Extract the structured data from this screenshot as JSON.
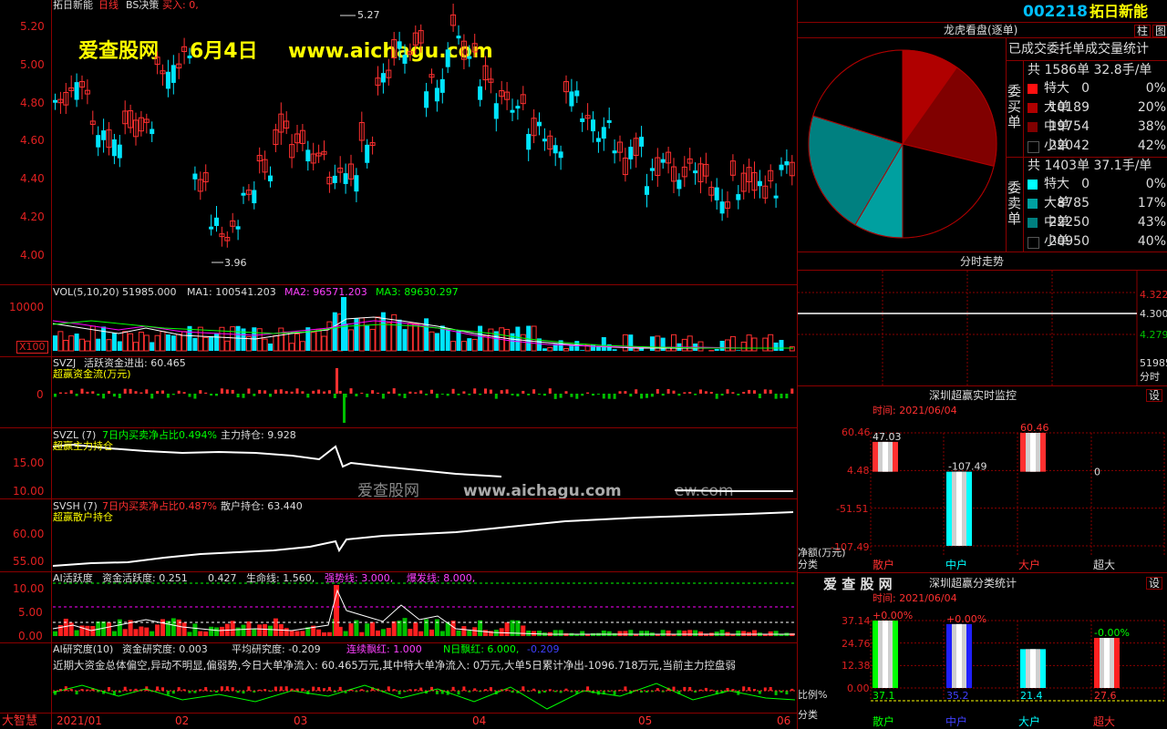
{
  "header": {
    "title": "拓日新能",
    "kline": "日线",
    "bs": "BS决策",
    "buy_label": "买入: 0,"
  },
  "watermark": {
    "site": "爱查股网",
    "date": "6月4日",
    "url": "www.aichagu.com",
    "mid_site": "爱查股网",
    "mid_url": "www.aichagu.com",
    "mid_tail": "ew.com"
  },
  "price_axis": [
    "5.20",
    "5.00",
    "4.80",
    "4.60",
    "4.40",
    "4.20",
    "4.00"
  ],
  "price_marks": {
    "high": "5.27",
    "low": "3.96"
  },
  "vol": {
    "label": "VOL(5,10,20)",
    "v": "51985.000",
    "ma1": "MA1: 100541.203",
    "ma2": "MA2: 96571.203",
    "ma3": "MA3: 89630.297",
    "axis": "10000",
    "unit": "X100"
  },
  "svzj": {
    "label": "SVZJ",
    "text1": "活跃资金进出: 60.465",
    "text2": "超赢资金流(万元)",
    "axis": "0"
  },
  "svzl": {
    "label": "SVZL (7)",
    "ratio": "7日内买卖净占比0.494%",
    "hold": "主力持仓: 9.928",
    "sub": "超赢主力持仓",
    "axis": [
      "15.00",
      "10.00"
    ]
  },
  "svsh": {
    "label": "SVSH (7)",
    "ratio": "7日内买卖净占比0.487%",
    "hold": "散户持仓: 63.440",
    "sub": "超赢散户持仓",
    "axis": [
      "60.00",
      "55.00"
    ]
  },
  "ai_act": {
    "label": "AI活跃度",
    "a": "资金活跃度: 0.251",
    "b": "0.427",
    "c": "生命线: 1.560,",
    "d": "强势线: 3.000,",
    "e": "爆发线: 8.000,",
    "axis": [
      "10.00",
      "5.00",
      "0.00"
    ]
  },
  "ai_res": {
    "label": "AI研究度(10)",
    "a": "资金研究度: 0.003",
    "b": "平均研究度: -0.209",
    "c": "连续飘红: 1.000",
    "d": "N日飘红: 6.000,",
    "e": "-0.209",
    "desc": "近期大资金总体偏空,异动不明显,偏弱势,今日大单净流入: 60.465万元,其中特大单净流入: 0万元,大单5日累计净出-1096.718万元,当前主力控盘弱"
  },
  "xaxis": {
    "left_label": "大智慧",
    "ticks": [
      "2021/01",
      "02",
      "03",
      "04",
      "05",
      "06"
    ]
  },
  "right": {
    "code": "002218",
    "name": "拓日新能",
    "btn1": "柱",
    "btn2": "图",
    "pie_title": "龙虎看盘(逐单)",
    "stat_title": "已成交委托单成交量统计",
    "buy_side": "委买单",
    "sell_side": "委卖单",
    "buy_total": "共 1586单 32.8手/单",
    "sell_total": "共 1403单 37.1手/单",
    "buy_rows": [
      {
        "k": "特大",
        "n": "0",
        "p": "0%"
      },
      {
        "k": "大单",
        "n": "10189",
        "p": "20%"
      },
      {
        "k": "中单",
        "n": "19754",
        "p": "38%"
      },
      {
        "k": "小单",
        "n": "22042",
        "p": "42%"
      }
    ],
    "sell_rows": [
      {
        "k": "特大",
        "n": "0",
        "p": "0%"
      },
      {
        "k": "大单",
        "n": "8785",
        "p": "17%"
      },
      {
        "k": "中单",
        "n": "22250",
        "p": "43%"
      },
      {
        "k": "小单",
        "n": "20950",
        "p": "40%"
      }
    ],
    "colors": {
      "buy": [
        "#ff1010",
        "#b00000",
        "#800000",
        "#000000"
      ],
      "sell": [
        "#00ffff",
        "#00a0a0",
        "#008080",
        "#000000"
      ]
    },
    "fenshi_title": "分时走势",
    "fenshi_axis": [
      "4.322",
      "4.300",
      "4.279"
    ],
    "fenshi_extra": "分时",
    "fenshi_extra2": "51985",
    "mon_title": "深圳超赢实时监控",
    "mon_btn": "设",
    "mon_time": "时间: 2021/06/04",
    "mon_axis": [
      "60.46",
      "4.48",
      "-51.51",
      "-107.49"
    ],
    "mon_vals": [
      "47.03",
      "-107.49",
      "60.46",
      "0"
    ],
    "mon_unit": "净额(万元)",
    "mon_cat": "分类",
    "cat_title": "深圳超赢分类统计",
    "cat_site": "爱 查 股 网",
    "cat_btn": "设",
    "cat_time": "时间: 2021/06/04",
    "cat_axis": [
      "37.14",
      "24.76",
      "12.38",
      "0.00"
    ],
    "cat_pct": [
      "+0.00%",
      "+0.00%",
      "",
      "-0.00%"
    ],
    "cat_vals": [
      "37.1",
      "35.2",
      "21.4",
      "27.6"
    ],
    "cat_unit": "比例%",
    "cat_cat": "分类",
    "groups": [
      "散户",
      "中户",
      "大户",
      "超大"
    ]
  },
  "chart_data": [
    {
      "type": "pie",
      "title": "龙虎看盘(逐单)",
      "categories": [
        "委买 特大",
        "委买 大单",
        "委买 中单",
        "委买 小单",
        "委卖 特大",
        "委卖 大单",
        "委卖 中单",
        "委卖 小单"
      ],
      "values": [
        0,
        10189,
        19754,
        22042,
        0,
        8785,
        22250,
        20950
      ]
    },
    {
      "type": "bar",
      "title": "深圳超赢实时监控",
      "categories": [
        "散户",
        "中户",
        "大户",
        "超大"
      ],
      "values": [
        47.03,
        -107.49,
        60.46,
        0
      ],
      "ylabel": "净额(万元)",
      "ylim": [
        -107.49,
        60.46
      ]
    },
    {
      "type": "bar",
      "title": "深圳超赢分类统计",
      "categories": [
        "散户",
        "中户",
        "大户",
        "超大"
      ],
      "values": [
        37.1,
        35.2,
        21.4,
        27.6
      ],
      "ylabel": "比例%",
      "ylim": [
        0,
        37.14
      ]
    }
  ]
}
